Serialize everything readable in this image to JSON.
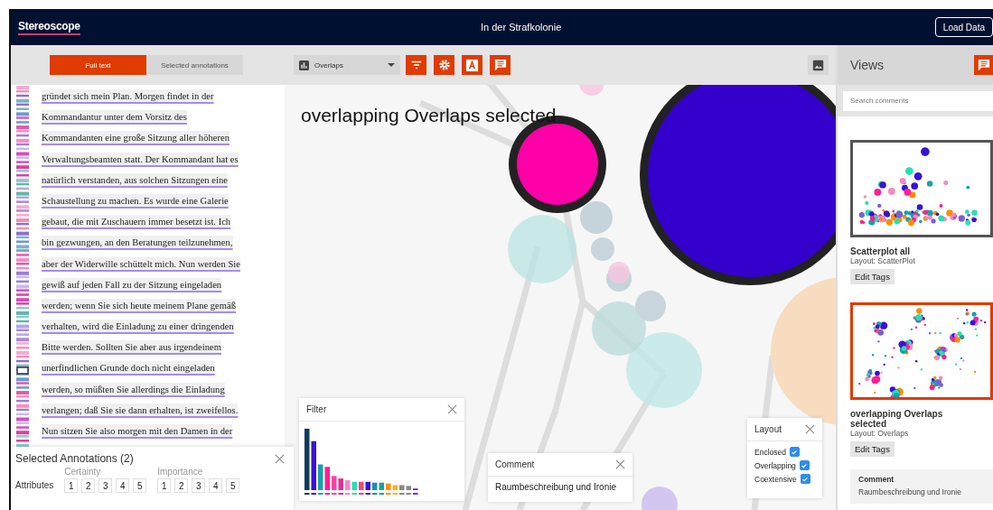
{
  "header": {
    "logo": "Stereoscope",
    "title": "In der Strafkolonie",
    "load_button": "Load Data"
  },
  "toolbar": {
    "tabs": [
      {
        "label": "Full text",
        "selected": true
      },
      {
        "label": "Selected annotations",
        "selected": false
      }
    ],
    "layout_select": "Overlaps"
  },
  "text_lines": [
    "gründet sich mein Plan. Morgen findet in der",
    "Kommandantur unter dem Vorsitz des",
    "Kommandanten eine große Sitzung aller höheren",
    "Verwaltungsbeamten statt. Der Kommandant hat es",
    "natürlich verstanden, aus solchen Sitzungen eine",
    "Schaustellung zu machen. Es wurde eine Galerie",
    "gebaut, die mit Zuschauern immer besetzt ist. Ich",
    "bin gezwungen, an den Beratungen teilzunehmen,",
    "aber der Widerwille schüttelt mich. Nun werden Sie",
    "gewiß auf jeden Fall zu der Sitzung eingeladen",
    "werden; wenn Sie sich heute meinem Plane gemäß",
    "verhalten, wird die Einladung zu einer dringenden",
    "Bitte werden. Sollten Sie aber aus irgendeinem",
    "unerfindlichen Grunde doch nicht eingeladen",
    "werden, so müßten Sie allerdings die Einladung",
    "verlangen; daß Sie sie dann erhalten, ist zweifellos.",
    "Nun sitzen Sie also morgen mit den Damen in der"
  ],
  "selected_annotations": {
    "title": "Selected Annotations (2)",
    "row_label": "Attributes",
    "groups": [
      {
        "label": "Certainty",
        "values": [
          "1",
          "2",
          "3",
          "4",
          "5"
        ]
      },
      {
        "label": "Importance",
        "values": [
          "1",
          "2",
          "3",
          "4",
          "5"
        ]
      }
    ]
  },
  "visualization": {
    "title": "overlapping Overlaps selected"
  },
  "filter_panel": {
    "title": "Filter"
  },
  "comment_panel": {
    "title": "Comment",
    "text": "Raumbeschreibung und Ironie"
  },
  "layout_panel": {
    "title": "Layout",
    "options": [
      {
        "label": "Enclosed",
        "checked": true
      },
      {
        "label": "Overlapping",
        "checked": true
      },
      {
        "label": "Coextensive",
        "checked": true
      }
    ]
  },
  "views": {
    "title": "Views",
    "search": {
      "placeholder": "Search comments"
    },
    "items": [
      {
        "kind": "scatter",
        "title": "Scatterplot all",
        "layout": "Layout: ScatterPlot",
        "button": "Edit Tags",
        "selected": false
      },
      {
        "kind": "clusters",
        "title": "overlapping Overlaps selected",
        "layout": "Layout: Overlaps",
        "button": "Edit Tags",
        "selected": true
      }
    ],
    "comment": {
      "title": "Comment",
      "text": "Raumbeschreibung und Ironie"
    }
  }
}
